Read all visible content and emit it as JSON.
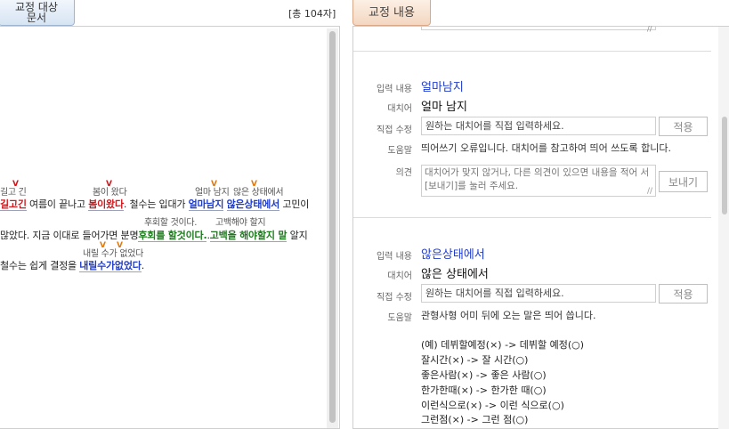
{
  "left": {
    "tab_label": "교정 대상\n문서",
    "total_count": "[총 104자]",
    "line1": {
      "s1": "길고긴",
      "t1": " 여름이 끝나고 ",
      "s2": "봄이왔다",
      "t2": ". 철수는 입대가 ",
      "s3": "얼마남지",
      "t3": " ",
      "s4": "않은상태에서",
      "t4": " 고민이"
    },
    "line1_hints": {
      "h1": "길고 긴",
      "h2": "봄이 왔다",
      "h3": "얼마 남지",
      "h4": "않은 상태에서"
    },
    "line2": {
      "t1": "많았다. 지금 이대로 들어가면 분명",
      "s1": "후회를 할것이다.",
      "t2": ".",
      "s2": "고백을 해야할지 말",
      "t3": " 알지"
    },
    "line2_hints": {
      "h1": "후회할 것이다.",
      "h2": "고백해야 할지"
    },
    "line3": {
      "t1": "철수는 쉽게 결정을 ",
      "s1": "내릴수가없었다",
      "t2": "."
    },
    "line3_hints": {
      "h1": "내릴 수가 없었다"
    },
    "marker": "V"
  },
  "right": {
    "tab_label": "교정 내용",
    "entries": [
      {
        "input_label": "입력 내용",
        "input_value": "얼마남지",
        "sub_label": "대치어",
        "sub_value": "얼마 남지",
        "direct_label": "직접 수정",
        "direct_placeholder": "원하는 대치어를 직접 입력하세요.",
        "apply_label": "적용",
        "help_label": "도움말",
        "help_text": "띄어쓰기 오류입니다. 대치어를 참고하여 띄어 쓰도록 합니다.",
        "opinion_label": "의견",
        "opinion_placeholder": "대치어가 맞지 않거나, 다른 의견이 있으면 내용을 적어 서 [보내기]를 눌러 주세요.",
        "send_label": "보내기"
      },
      {
        "input_label": "입력 내용",
        "input_value": "않은상태에서",
        "sub_label": "대치어",
        "sub_value": "않은 상태에서",
        "direct_label": "직접 수정",
        "direct_placeholder": "원하는 대치어를 직접 입력하세요.",
        "apply_label": "적용",
        "help_label": "도움말",
        "help_text": "관형사형 어미 뒤에 오는 말은 띄어 씁니다.",
        "examples": [
          "(예) 데뷔할예정(×) -> 데뷔할 예정(○)",
          "잘시간(×) -> 잘 시간(○)",
          "좋은사람(×) -> 좋은 사람(○)",
          "한가한때(×) -> 한가한 때(○)",
          "이런식으로(×) -> 이런 식으로(○)",
          "그런점(×) -> 그런 점(○)"
        ]
      }
    ]
  },
  "colors": {
    "error_red": "#d0171c",
    "error_blue": "#1f3cc9",
    "error_green": "#1d7a1d",
    "marker_orange": "#e07a10"
  }
}
